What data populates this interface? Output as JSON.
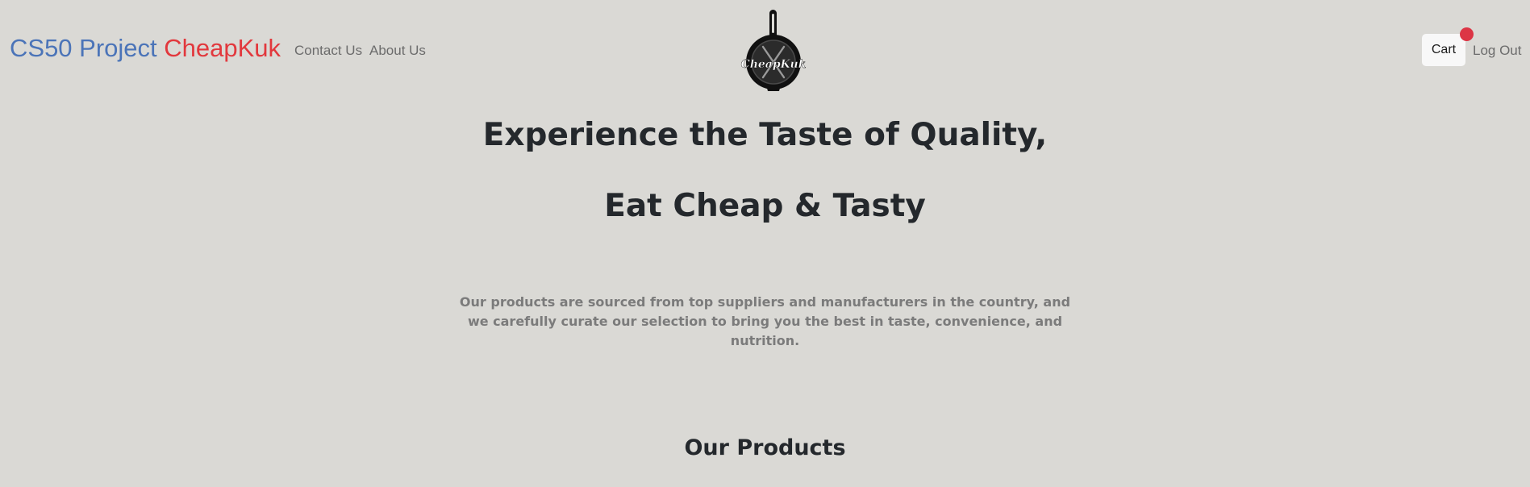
{
  "navbar": {
    "brand_part1": "CS50 Project",
    "brand_part2": "CheapKuk",
    "links": [
      {
        "label": "Contact Us"
      },
      {
        "label": "About Us"
      }
    ],
    "logo_text": "CheapKuk",
    "logo_icon": "frying-pan-logo",
    "cart_label": "Cart",
    "logout_label": "Log Out"
  },
  "hero": {
    "line1": "Experience the Taste of Quality,",
    "line2": "Eat Cheap & Tasty",
    "tagline": "Our products are sourced from top suppliers and manufacturers in the country, and we carefully curate our selection to bring you the best in taste, convenience, and nutrition."
  },
  "products": {
    "title": "Our Products"
  },
  "colors": {
    "background": "#dad9d5",
    "brand_blue": "#4b74b8",
    "brand_red": "#e2383d",
    "badge_red": "#dc3545"
  }
}
